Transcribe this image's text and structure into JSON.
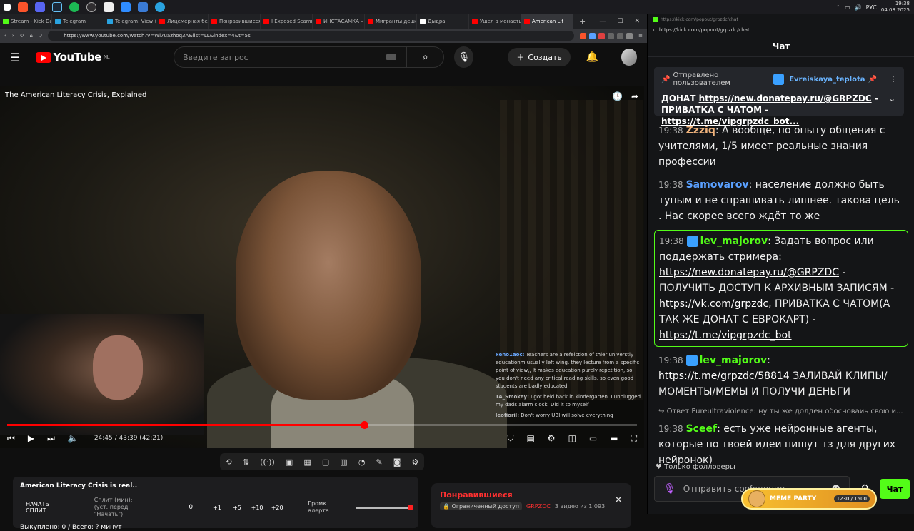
{
  "taskbar": {
    "lang": "РУС",
    "time": "19:38",
    "date": "04.08.2025"
  },
  "browser": {
    "tabs": [
      {
        "label": "Stream - Kick Da",
        "color": "#53fc18"
      },
      {
        "label": "Telegram",
        "color": "#2aa3e0"
      },
      {
        "label": "Telegram: View @",
        "color": "#2aa3e0"
      },
      {
        "label": "Лицемерная бе",
        "color": "#ff0000"
      },
      {
        "label": "Понравившиеся",
        "color": "#ff0000"
      },
      {
        "label": "I Exposed Scamm",
        "color": "#ff0000"
      },
      {
        "label": "ИНСТАСАМКА –",
        "color": "#ff0000"
      },
      {
        "label": "Мигранты деше",
        "color": "#ff0000"
      },
      {
        "label": "Дыдра",
        "color": "#ffffff"
      },
      {
        "label": "Ушел в монасты",
        "color": "#ff0000"
      },
      {
        "label": "American Lit",
        "color": "#ff0000"
      }
    ],
    "url": "https://www.youtube.com/watch?v=Wl7uazhoq3A&list=LL&index=4&t=5s"
  },
  "youtube": {
    "logo": "YouTube",
    "region": "NL",
    "search_placeholder": "Введите запрос",
    "create_label": "Создать"
  },
  "video": {
    "title": "The American Literacy Crisis, Explained",
    "time": "24:45 / 43:39 (42:21)",
    "progress": 0.567,
    "overlay_chat": [
      {
        "name": "xeno1aoc:",
        "text": "Teachers are a refelction of thier universtiy educationm usually left wing. they lecture from a specific point of view,, It makes education purely repetition, so you don't need any critical reading skills, so even good students are badly educated"
      },
      {
        "name": "TA_Smokey:",
        "text": "I got held back in kindergarten. I unplugged my dads alarm clock. Did it to myself"
      },
      {
        "name": "leofioril:",
        "text": "Don't worry UBI will solve everything"
      }
    ]
  },
  "split": {
    "title": "American Literacy Crisis is real..",
    "start": "НАЧАТЬ СПЛИТ",
    "split_label": "Сплит (мин):",
    "split_hint": "(уст. перед \"Начать\")",
    "value": "0",
    "increments": [
      "+1",
      "+5",
      "+10",
      "+20"
    ],
    "volume_label": "Громк. алерта:",
    "footer": "Выкуплено: 0 / Всего: ? минут"
  },
  "liked": {
    "title": "Понравившиеся",
    "access": "Ограниченный доступ",
    "channel": "GRPZDC",
    "count": "3 видео из 1 093"
  },
  "kick": {
    "url": "https://kick.com/popout/grpzdc/chat",
    "header": "Чат",
    "pinned_by_label": "Отправлено пользователем",
    "pinned_user": "Evreiskaya_teplota",
    "pinned_text_1": "ДОНАТ",
    "pinned_link_1": "https://new.donatepay.ru/@GRPZDC",
    "pinned_text_2": "- ПРИВАТКА С ЧАТОМ -",
    "pinned_link_2": "https://t.me/vipgrpzdc_bot...",
    "messages": [
      {
        "time": "19:38",
        "user": "Zzziq",
        "color": "#f0b37c",
        "text": "А вообще, по опыту общения с учителями, 1/5 имеет реальные знания профессии"
      },
      {
        "time": "19:38",
        "user": "Samovarov",
        "color": "#5aa0ff",
        "text": "население должно быть тупым и не спрашивать лишнее. такова цель . Нас скорее всего ждёт то же"
      },
      {
        "time": "19:38",
        "user": "lev_majorov",
        "color": "#53fc18",
        "text_a": "Задать вопрос или поддержать стримера:",
        "link_a": "https://new.donatepay.ru/@GRPZDC",
        "text_b": "- ПОЛУЧИТЬ ДОСТУП К АРХИВНЫМ ЗАПИСЯМ -",
        "link_b": "https://vk.com/grpzdc",
        "text_c": ", ПРИВАТКА С ЧАТОМ(А ТАК ЖЕ ДОНАТ С ЕВРОКАРТ) -",
        "link_c": "https://t.me/vipgrpzdc_bot"
      },
      {
        "time": "19:38",
        "user": "lev_majorov",
        "color": "#53fc18",
        "link": "https://t.me/grpzdc/58814",
        "text": "ЗАЛИВАЙ КЛИПЫ/МОМЕНТЫ/МЕМЫ И ПОЛУЧИ ДЕНЬГИ"
      },
      {
        "reply": "Ответ Pureultraviolence: ну ты же долден обосноваиь свою и...",
        "time": "19:38",
        "user": "Sceef",
        "color": "#53fc18",
        "text": "есть уже нейронные агенты, которые по твоей идеи пишут тз для других нейронок)"
      }
    ],
    "followers_only": "Только фолловеры",
    "compose_placeholder": "Отправить сообщение...",
    "send_label": "Чат",
    "meme_title": "MEME PARTY",
    "meme_progress": "1230 / 1500"
  }
}
